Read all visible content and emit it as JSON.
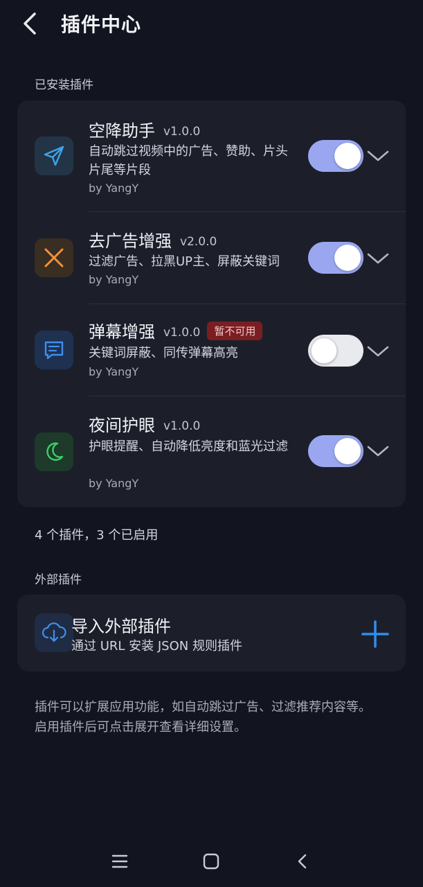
{
  "header": {
    "title": "插件中心"
  },
  "installed": {
    "section_title": "已安装插件",
    "plugins": [
      {
        "name": "空降助手",
        "version": "v1.0.0",
        "badge": "",
        "description": "自动跳过视频中的广告、赞助、片头片尾等片段",
        "author": "by YangY",
        "enabled": true,
        "icon": "paper-plane-icon",
        "icon_color": "#3fa3e8"
      },
      {
        "name": "去广告增强",
        "version": "v2.0.0",
        "badge": "",
        "description": "过滤广告、拉黑UP主、屏蔽关键词",
        "author": "by YangY",
        "enabled": true,
        "icon": "close-x-icon",
        "icon_color": "#f0923a"
      },
      {
        "name": "弹幕增强",
        "version": "v1.0.0",
        "badge": "暂不可用",
        "description": "关键词屏蔽、同传弹幕高亮",
        "author": "by YangY",
        "enabled": false,
        "icon": "chat-bubble-icon",
        "icon_color": "#3f8ff0"
      },
      {
        "name": "夜间护眼",
        "version": "v1.0.0",
        "badge": "",
        "description": "护眼提醒、自动降低亮度和蓝光过滤",
        "author": "by YangY",
        "enabled": true,
        "icon": "moon-icon",
        "icon_color": "#3ccf6a"
      }
    ],
    "summary": "4 个插件，3 个已启用"
  },
  "external": {
    "section_title": "外部插件",
    "title": "导入外部插件",
    "description": "通过 URL 安装 JSON 规则插件",
    "icon": "cloud-download-icon"
  },
  "footer_note": {
    "line1": "插件可以扩展应用功能，如自动跳过广告、过滤推荐内容等。",
    "line2": "启用插件后可点击展开查看详细设置。"
  },
  "colors": {
    "background": "#121520",
    "card": "#1c1f2a",
    "toggle_on": "#9aa7f0",
    "accent": "#2e8ff0",
    "badge": "#7a1e22"
  }
}
